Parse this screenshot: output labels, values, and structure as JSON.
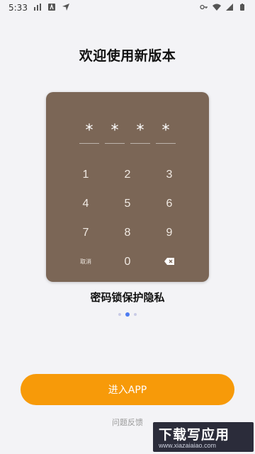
{
  "status_bar": {
    "time": "5:33"
  },
  "title": "欢迎使用新版本",
  "lock_demo": {
    "pin_chars": [
      "*",
      "*",
      "*",
      "*"
    ],
    "keypad_rows": [
      [
        "1",
        "2",
        "3"
      ],
      [
        "4",
        "5",
        "6"
      ],
      [
        "7",
        "8",
        "9"
      ],
      [
        "取消",
        "0",
        "delete"
      ]
    ],
    "colors": {
      "card": "#7b6656"
    }
  },
  "subtitle": "密码锁保护隐私",
  "pager": {
    "count": 3,
    "active_index": 1,
    "active_color": "#4d7cf1"
  },
  "enter_button": {
    "label": "进入APP",
    "color": "#f79a09"
  },
  "feedback_link": "问题反馈",
  "watermark": {
    "main": "下载写应用",
    "sub": "www.xiazaiaiao.com"
  }
}
